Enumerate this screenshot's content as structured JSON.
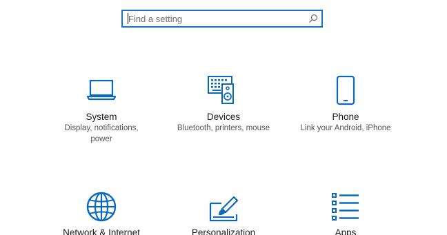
{
  "search": {
    "placeholder": "Find a setting",
    "icon": "search-icon"
  },
  "accent_color": "#0a68c0",
  "tiles": [
    {
      "name": "system",
      "title": "System",
      "description": "Display, notifications, power",
      "icon": "laptop-icon"
    },
    {
      "name": "devices",
      "title": "Devices",
      "description": "Bluetooth, printers, mouse",
      "icon": "keyboard-speaker-icon"
    },
    {
      "name": "phone",
      "title": "Phone",
      "description": "Link your Android, iPhone",
      "icon": "phone-icon"
    },
    {
      "name": "network",
      "title": "Network & Internet",
      "description": "",
      "icon": "globe-icon"
    },
    {
      "name": "personalization",
      "title": "Personalization",
      "description": "",
      "icon": "paint-brush-icon"
    },
    {
      "name": "apps",
      "title": "Apps",
      "description": "",
      "icon": "apps-list-icon"
    }
  ]
}
